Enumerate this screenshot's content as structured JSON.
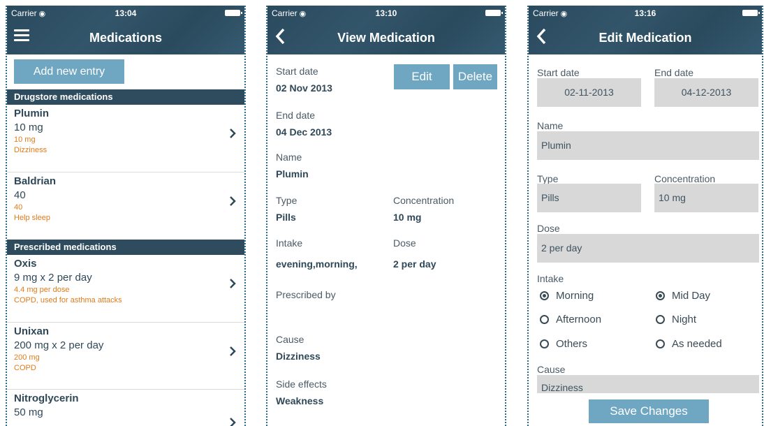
{
  "status": {
    "carrier": "Carrier",
    "time1": "13:04",
    "time2": "13:10",
    "time3": "13:16"
  },
  "screen1": {
    "title": "Medications",
    "add_label": "Add new entry",
    "section_drugstore": "Drugstore medications",
    "section_prescribed": "Prescribed medications",
    "drugstore": [
      {
        "name": "Plumin",
        "dose": "10 mg",
        "sub1": "10 mg",
        "sub2": "Dizziness"
      },
      {
        "name": "Baldrian",
        "dose": "40",
        "sub1": "40",
        "sub2": "Help sleep"
      }
    ],
    "prescribed": [
      {
        "name": "Oxis",
        "dose": "9 mg x 2 per day",
        "sub1": "4.4 mg per dose",
        "sub2": "COPD, used for asthma attacks"
      },
      {
        "name": "Unixan",
        "dose": "200 mg x 2 per day",
        "sub1": "200 mg",
        "sub2": "COPD"
      },
      {
        "name": "Nitroglycerin",
        "dose": "50 mg",
        "sub1": "",
        "sub2": ""
      }
    ]
  },
  "screen2": {
    "title": "View Medication",
    "edit_label": "Edit",
    "delete_label": "Delete",
    "start_label": "Start date",
    "start_value": "02 Nov 2013",
    "end_label": "End date",
    "end_value": "04 Dec 2013",
    "name_label": "Name",
    "name_value": "Plumin",
    "type_label": "Type",
    "type_value": "Pills",
    "conc_label": "Concentration",
    "conc_value": "10 mg",
    "intake_label": "Intake",
    "intake_value": "evening,morning,",
    "dose_label": "Dose",
    "dose_value": "2 per day",
    "prescribed_label": "Prescribed by",
    "cause_label": "Cause",
    "cause_value": "Dizziness",
    "side_label": "Side effects",
    "side_value": "Weakness"
  },
  "screen3": {
    "title": "Edit Medication",
    "start_label": "Start date",
    "start_value": "02-11-2013",
    "end_label": "End date",
    "end_value": "04-12-2013",
    "name_label": "Name",
    "name_value": "Plumin",
    "type_label": "Type",
    "type_value": "Pills",
    "conc_label": "Concentration",
    "conc_value": "10 mg",
    "dose_label": "Dose",
    "dose_value": "2 per day",
    "intake_label": "Intake",
    "intake_options": [
      {
        "label": "Morning",
        "checked": true
      },
      {
        "label": "Mid Day",
        "checked": true
      },
      {
        "label": "Afternoon",
        "checked": false
      },
      {
        "label": "Night",
        "checked": false
      },
      {
        "label": "Others",
        "checked": false
      },
      {
        "label": "As needed",
        "checked": false
      }
    ],
    "cause_label": "Cause",
    "cause_value": "Dizziness",
    "save_label": "Save Changes"
  },
  "colors": {
    "header": "#2a4a5e",
    "button": "#6fa6c2",
    "accent_orange": "#e07b19",
    "section": "#2e4c5e"
  },
  "icons": {
    "menu": "hamburger-menu-icon",
    "back": "chevron-left-icon",
    "disclosure": "chevron-right-icon",
    "wifi": "wifi-icon",
    "battery": "battery-icon"
  }
}
